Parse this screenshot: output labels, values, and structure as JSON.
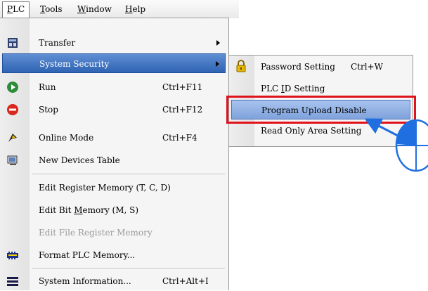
{
  "menubar": {
    "items": [
      {
        "label": "PLC",
        "accel": "P",
        "rest": "LC"
      },
      {
        "label": "Tools",
        "accel": "T",
        "rest": "ools"
      },
      {
        "label": "Window",
        "accel": "W",
        "rest": "indow"
      },
      {
        "label": "Help",
        "accel": "H",
        "rest": "elp"
      }
    ]
  },
  "menu": {
    "items": [
      {
        "label": "Transfer",
        "icon": "transfer-icon"
      },
      {
        "label": "System Security",
        "icon": "",
        "highlighted": true
      },
      {
        "label": "Run",
        "shortcut": "Ctrl+F11",
        "icon": "run-icon"
      },
      {
        "label": "Stop",
        "shortcut": "Ctrl+F12",
        "icon": "stop-icon"
      },
      {
        "label": "Online Mode",
        "shortcut": "Ctrl+F4",
        "icon": "online-mode-icon"
      },
      {
        "label": "New Devices Table",
        "icon": "devices-table-icon"
      },
      {
        "label": "Edit Register Memory (T, C, D)"
      },
      {
        "pre": "Edit Bit ",
        "accel": "M",
        "post": "emory (M, S)"
      },
      {
        "label": "Edit File Register Memory",
        "disabled": true
      },
      {
        "label": "Format PLC Memory...",
        "icon": "format-memory-icon"
      },
      {
        "label": "System Information...",
        "shortcut": "Ctrl+Alt+I",
        "icon": "system-information-icon"
      }
    ]
  },
  "submenu": {
    "items": [
      {
        "label": "Password Setting",
        "shortcut": "Ctrl+W",
        "icon": "lock-icon"
      },
      {
        "pre": "PLC ",
        "accel": "I",
        "post": "D Setting"
      },
      {
        "label": "Program Upload Disable",
        "highlighted": true
      },
      {
        "label": "Read Only Area Setting"
      }
    ]
  },
  "colors": {
    "highlight": "#2f63b2",
    "sub_highlight": "#7fa2dc",
    "callout": "#e0131d",
    "pointer": "#1f6fe0"
  }
}
